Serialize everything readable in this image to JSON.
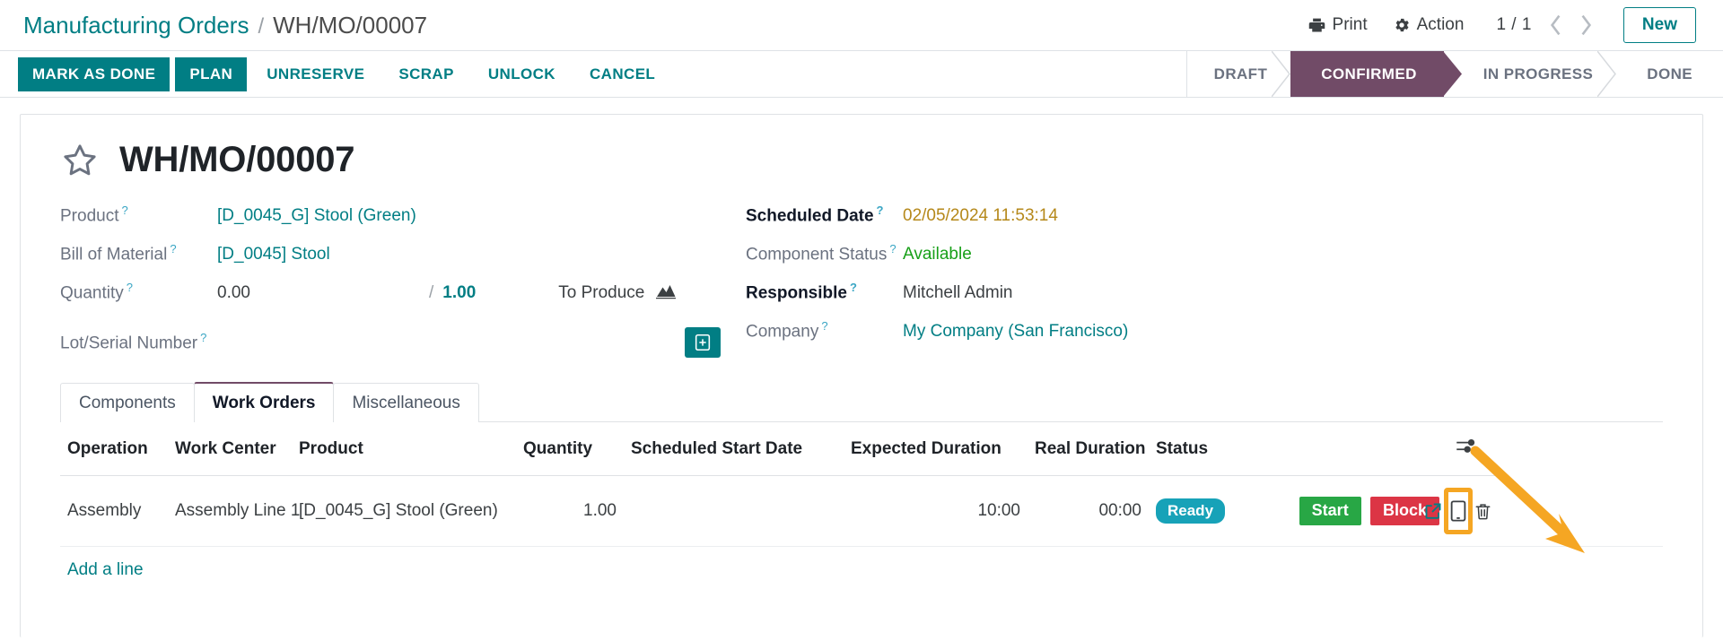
{
  "breadcrumb": {
    "root": "Manufacturing Orders",
    "separator": "/",
    "current": "WH/MO/00007"
  },
  "topbar": {
    "print_label": "Print",
    "print_icon": "printer-icon",
    "action_label": "Action",
    "action_icon": "gear-icon",
    "pager": "1 / 1",
    "prev_icon": "chevron-left-icon",
    "next_icon": "chevron-right-icon",
    "new_label": "New"
  },
  "actionbar": {
    "buttons": [
      {
        "label": "MARK AS DONE",
        "style": "primary"
      },
      {
        "label": "PLAN",
        "style": "primary"
      },
      {
        "label": "UNRESERVE",
        "style": "text"
      },
      {
        "label": "SCRAP",
        "style": "text"
      },
      {
        "label": "UNLOCK",
        "style": "text"
      },
      {
        "label": "CANCEL",
        "style": "text"
      }
    ],
    "accent_color": "#017e84"
  },
  "statusflow": {
    "active_color": "#714b67",
    "stages": [
      {
        "label": "DRAFT",
        "active": false
      },
      {
        "label": "CONFIRMED",
        "active": true
      },
      {
        "label": "IN PROGRESS",
        "active": false
      },
      {
        "label": "DONE",
        "active": false
      }
    ]
  },
  "record": {
    "star_icon": "star-outline-icon",
    "title": "WH/MO/00007"
  },
  "form": {
    "left": {
      "product_label": "Product",
      "product_value": "[D_0045_G] Stool (Green)",
      "bom_label": "Bill of Material",
      "bom_value": "[D_0045] Stool",
      "quantity_label": "Quantity",
      "quantity_done": "0.00",
      "quantity_slash": "/",
      "quantity_target": "1.00",
      "to_produce_label": "To Produce",
      "to_produce_icon": "mountain-chart-icon",
      "lot_label": "Lot/Serial Number",
      "lot_add_icon": "add-box-icon"
    },
    "right": {
      "scheduled_date_label": "Scheduled Date",
      "scheduled_date_value": "02/05/2024 11:53:14",
      "component_status_label": "Component Status",
      "component_status_value": "Available",
      "responsible_label": "Responsible",
      "responsible_value": "Mitchell Admin",
      "company_label": "Company",
      "company_value": "My Company (San Francisco)"
    },
    "tooltip_marker": "?"
  },
  "notebook": {
    "tabs": [
      {
        "label": "Components",
        "active": false
      },
      {
        "label": "Work Orders",
        "active": true
      },
      {
        "label": "Miscellaneous",
        "active": false
      }
    ]
  },
  "work_orders_table": {
    "columns": [
      "Operation",
      "Work Center",
      "Product",
      "Quantity",
      "Scheduled Start Date",
      "Expected Duration",
      "Real Duration",
      "Status"
    ],
    "options_icon": "table-options-icon",
    "rows": [
      {
        "operation": "Assembly",
        "work_center": "Assembly Line 1",
        "product": "[D_0045_G] Stool (Green)",
        "quantity": "1.00",
        "scheduled_start_date": "",
        "expected_duration": "10:00",
        "real_duration": "00:00",
        "status": "Ready",
        "status_color": "#17a2b8",
        "start_label": "Start",
        "block_label": "Block",
        "open_icon": "external-link-icon",
        "tablet_icon": "tablet-view-icon",
        "delete_icon": "trash-icon"
      }
    ],
    "add_line_label": "Add a line"
  },
  "annotation": {
    "highlight_color": "#f5a623",
    "arrow_icon": "pointer-arrow-icon",
    "target": "tablet-view-icon"
  }
}
